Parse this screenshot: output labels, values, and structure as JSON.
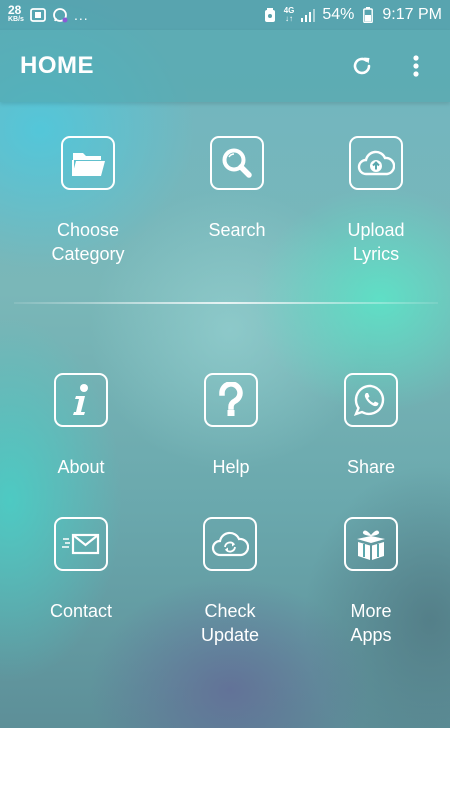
{
  "statusbar": {
    "speed_value": "28",
    "speed_unit": "KB/s",
    "net_type": "4G",
    "battery_percent": "54%",
    "time": "9:17 PM",
    "left_icons": [
      "notification-icon",
      "whatsapp-icon"
    ],
    "more_indicator": "..."
  },
  "appbar": {
    "title": "HOME",
    "actions": [
      "refresh-icon",
      "overflow-menu-icon"
    ]
  },
  "top_section": [
    {
      "label": "Choose\nCategory",
      "icon": "folder-icon"
    },
    {
      "label": "Search",
      "icon": "search-icon"
    },
    {
      "label": "Upload\nLyrics",
      "icon": "cloud-upload-icon"
    }
  ],
  "bottom_section": [
    {
      "label": "About",
      "icon": "info-icon"
    },
    {
      "label": "Help",
      "icon": "help-icon"
    },
    {
      "label": "Share",
      "icon": "whatsapp-icon"
    },
    {
      "label": "Contact",
      "icon": "mail-icon"
    },
    {
      "label": "Check\nUpdate",
      "icon": "cloud-sync-icon"
    },
    {
      "label": "More\nApps",
      "icon": "gift-box-icon"
    }
  ],
  "colors": {
    "appbar": "#50a5ac",
    "text": "#ffffff"
  }
}
